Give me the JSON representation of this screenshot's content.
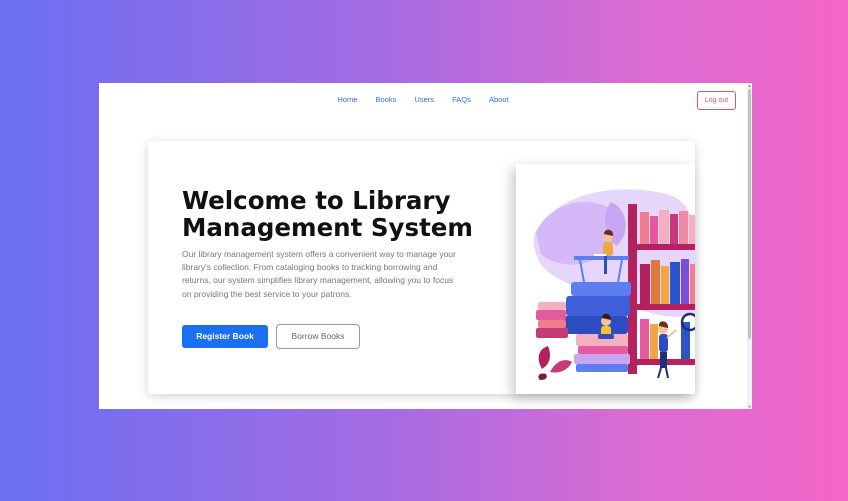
{
  "nav": {
    "items": [
      {
        "label": "Home"
      },
      {
        "label": "Books"
      },
      {
        "label": "Users"
      },
      {
        "label": "FAQs"
      },
      {
        "label": "About"
      }
    ],
    "logout_label": "Log out"
  },
  "hero": {
    "title": "Welcome to Library Management System",
    "description": "Our library management system offers a convenient way to manage your library's collection. From cataloging books to tracking borrowing and returns, our system simplifies library management, allowing you to focus on providing the best service to your patrons.",
    "primary_button": "Register Book",
    "secondary_button": "Borrow Books"
  },
  "colors": {
    "accent": "#1b6ff1",
    "link": "#2b6ff0",
    "logout": "#e05566"
  },
  "illustration": {
    "icon": "library-illustration"
  }
}
